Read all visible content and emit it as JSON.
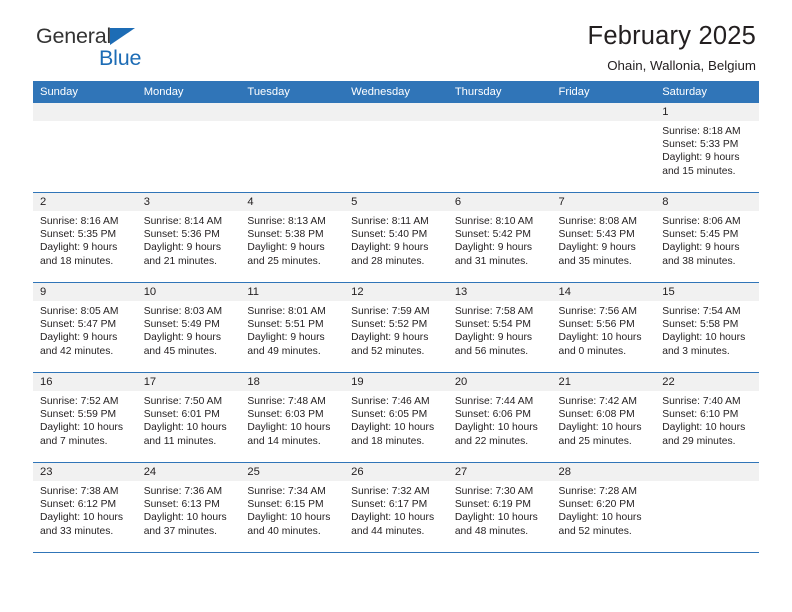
{
  "brand": {
    "name_part1": "General",
    "name_part2": "Blue",
    "accent_color": "#1d6cb5"
  },
  "header": {
    "title": "February 2025",
    "subtitle": "Ohain, Wallonia, Belgium"
  },
  "calendar": {
    "header_color": "#3075b8",
    "daynum_bg": "#f1f1f1",
    "weekdays": [
      "Sunday",
      "Monday",
      "Tuesday",
      "Wednesday",
      "Thursday",
      "Friday",
      "Saturday"
    ],
    "weeks": [
      [
        {
          "day": "",
          "lines": []
        },
        {
          "day": "",
          "lines": []
        },
        {
          "day": "",
          "lines": []
        },
        {
          "day": "",
          "lines": []
        },
        {
          "day": "",
          "lines": []
        },
        {
          "day": "",
          "lines": []
        },
        {
          "day": "1",
          "lines": [
            "Sunrise: 8:18 AM",
            "Sunset: 5:33 PM",
            "Daylight: 9 hours",
            "and 15 minutes."
          ]
        }
      ],
      [
        {
          "day": "2",
          "lines": [
            "Sunrise: 8:16 AM",
            "Sunset: 5:35 PM",
            "Daylight: 9 hours",
            "and 18 minutes."
          ]
        },
        {
          "day": "3",
          "lines": [
            "Sunrise: 8:14 AM",
            "Sunset: 5:36 PM",
            "Daylight: 9 hours",
            "and 21 minutes."
          ]
        },
        {
          "day": "4",
          "lines": [
            "Sunrise: 8:13 AM",
            "Sunset: 5:38 PM",
            "Daylight: 9 hours",
            "and 25 minutes."
          ]
        },
        {
          "day": "5",
          "lines": [
            "Sunrise: 8:11 AM",
            "Sunset: 5:40 PM",
            "Daylight: 9 hours",
            "and 28 minutes."
          ]
        },
        {
          "day": "6",
          "lines": [
            "Sunrise: 8:10 AM",
            "Sunset: 5:42 PM",
            "Daylight: 9 hours",
            "and 31 minutes."
          ]
        },
        {
          "day": "7",
          "lines": [
            "Sunrise: 8:08 AM",
            "Sunset: 5:43 PM",
            "Daylight: 9 hours",
            "and 35 minutes."
          ]
        },
        {
          "day": "8",
          "lines": [
            "Sunrise: 8:06 AM",
            "Sunset: 5:45 PM",
            "Daylight: 9 hours",
            "and 38 minutes."
          ]
        }
      ],
      [
        {
          "day": "9",
          "lines": [
            "Sunrise: 8:05 AM",
            "Sunset: 5:47 PM",
            "Daylight: 9 hours",
            "and 42 minutes."
          ]
        },
        {
          "day": "10",
          "lines": [
            "Sunrise: 8:03 AM",
            "Sunset: 5:49 PM",
            "Daylight: 9 hours",
            "and 45 minutes."
          ]
        },
        {
          "day": "11",
          "lines": [
            "Sunrise: 8:01 AM",
            "Sunset: 5:51 PM",
            "Daylight: 9 hours",
            "and 49 minutes."
          ]
        },
        {
          "day": "12",
          "lines": [
            "Sunrise: 7:59 AM",
            "Sunset: 5:52 PM",
            "Daylight: 9 hours",
            "and 52 minutes."
          ]
        },
        {
          "day": "13",
          "lines": [
            "Sunrise: 7:58 AM",
            "Sunset: 5:54 PM",
            "Daylight: 9 hours",
            "and 56 minutes."
          ]
        },
        {
          "day": "14",
          "lines": [
            "Sunrise: 7:56 AM",
            "Sunset: 5:56 PM",
            "Daylight: 10 hours",
            "and 0 minutes."
          ]
        },
        {
          "day": "15",
          "lines": [
            "Sunrise: 7:54 AM",
            "Sunset: 5:58 PM",
            "Daylight: 10 hours",
            "and 3 minutes."
          ]
        }
      ],
      [
        {
          "day": "16",
          "lines": [
            "Sunrise: 7:52 AM",
            "Sunset: 5:59 PM",
            "Daylight: 10 hours",
            "and 7 minutes."
          ]
        },
        {
          "day": "17",
          "lines": [
            "Sunrise: 7:50 AM",
            "Sunset: 6:01 PM",
            "Daylight: 10 hours",
            "and 11 minutes."
          ]
        },
        {
          "day": "18",
          "lines": [
            "Sunrise: 7:48 AM",
            "Sunset: 6:03 PM",
            "Daylight: 10 hours",
            "and 14 minutes."
          ]
        },
        {
          "day": "19",
          "lines": [
            "Sunrise: 7:46 AM",
            "Sunset: 6:05 PM",
            "Daylight: 10 hours",
            "and 18 minutes."
          ]
        },
        {
          "day": "20",
          "lines": [
            "Sunrise: 7:44 AM",
            "Sunset: 6:06 PM",
            "Daylight: 10 hours",
            "and 22 minutes."
          ]
        },
        {
          "day": "21",
          "lines": [
            "Sunrise: 7:42 AM",
            "Sunset: 6:08 PM",
            "Daylight: 10 hours",
            "and 25 minutes."
          ]
        },
        {
          "day": "22",
          "lines": [
            "Sunrise: 7:40 AM",
            "Sunset: 6:10 PM",
            "Daylight: 10 hours",
            "and 29 minutes."
          ]
        }
      ],
      [
        {
          "day": "23",
          "lines": [
            "Sunrise: 7:38 AM",
            "Sunset: 6:12 PM",
            "Daylight: 10 hours",
            "and 33 minutes."
          ]
        },
        {
          "day": "24",
          "lines": [
            "Sunrise: 7:36 AM",
            "Sunset: 6:13 PM",
            "Daylight: 10 hours",
            "and 37 minutes."
          ]
        },
        {
          "day": "25",
          "lines": [
            "Sunrise: 7:34 AM",
            "Sunset: 6:15 PM",
            "Daylight: 10 hours",
            "and 40 minutes."
          ]
        },
        {
          "day": "26",
          "lines": [
            "Sunrise: 7:32 AM",
            "Sunset: 6:17 PM",
            "Daylight: 10 hours",
            "and 44 minutes."
          ]
        },
        {
          "day": "27",
          "lines": [
            "Sunrise: 7:30 AM",
            "Sunset: 6:19 PM",
            "Daylight: 10 hours",
            "and 48 minutes."
          ]
        },
        {
          "day": "28",
          "lines": [
            "Sunrise: 7:28 AM",
            "Sunset: 6:20 PM",
            "Daylight: 10 hours",
            "and 52 minutes."
          ]
        },
        {
          "day": "",
          "lines": []
        }
      ]
    ]
  }
}
